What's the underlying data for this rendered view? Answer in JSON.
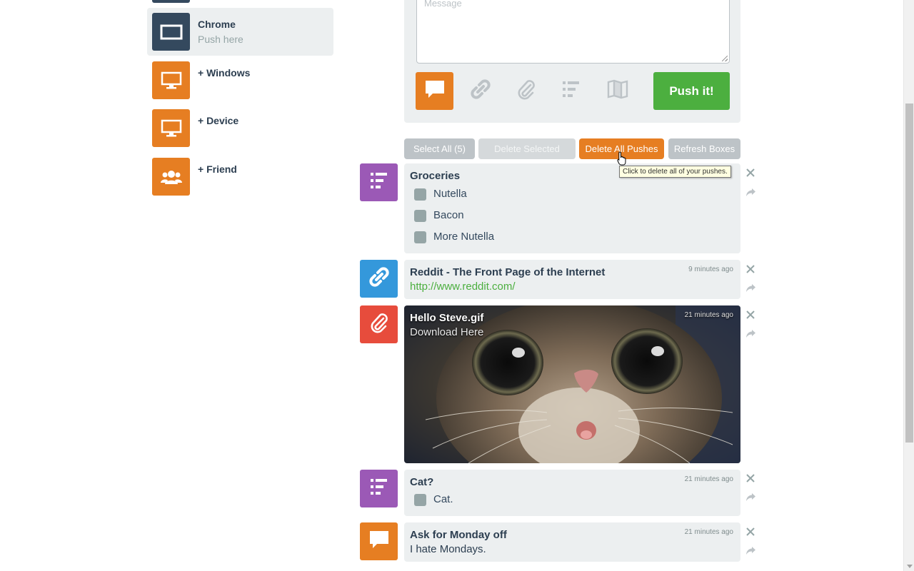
{
  "sidebar": {
    "devices": [
      {
        "name": "Chrome",
        "subtitle": "Push here",
        "icon": "monitor-icon",
        "color": "#34495e",
        "active": true
      },
      {
        "name": "+ Windows",
        "icon": "desktop-icon",
        "color": "#e67e22"
      },
      {
        "name": "+ Device",
        "icon": "desktop-icon",
        "color": "#e67e22"
      },
      {
        "name": "+ Friend",
        "icon": "friends-icon",
        "color": "#e67e22"
      }
    ]
  },
  "composer": {
    "message_placeholder": "Message",
    "push_button": "Push it!",
    "types": [
      "note-icon",
      "link-icon",
      "attachment-icon",
      "list-icon",
      "map-icon"
    ]
  },
  "toolbar": {
    "select_all": "Select All (5)",
    "delete_selected": "Delete Selected",
    "delete_all": "Delete All Pushes",
    "refresh": "Refresh Boxes",
    "tooltip": "Click to delete all of your pushes."
  },
  "pushes": [
    {
      "type": "list",
      "title": "Groceries",
      "items": [
        "Nutella",
        "Bacon",
        "More Nutella"
      ],
      "icon": "list-icon"
    },
    {
      "type": "link",
      "title": "Reddit - The Front Page of the Internet",
      "url": "http://www.reddit.com/",
      "time": "9 minutes ago",
      "icon": "link-icon"
    },
    {
      "type": "file",
      "title": "Hello Steve.gif",
      "subtitle": "Download Here",
      "time": "21 minutes ago",
      "icon": "attachment-icon"
    },
    {
      "type": "list",
      "title": "Cat?",
      "items": [
        "Cat."
      ],
      "time": "21 minutes ago",
      "icon": "list-icon"
    },
    {
      "type": "note",
      "title": "Ask for Monday off",
      "body": "I hate Mondays.",
      "time": "21 minutes ago",
      "icon": "note-icon"
    }
  ],
  "colors": {
    "accent": "#e67e22",
    "push_green": "#4caf3f",
    "list_purple": "#9b59b6",
    "link_blue": "#3498db",
    "file_red": "#e74c3c",
    "navy": "#34495e"
  }
}
